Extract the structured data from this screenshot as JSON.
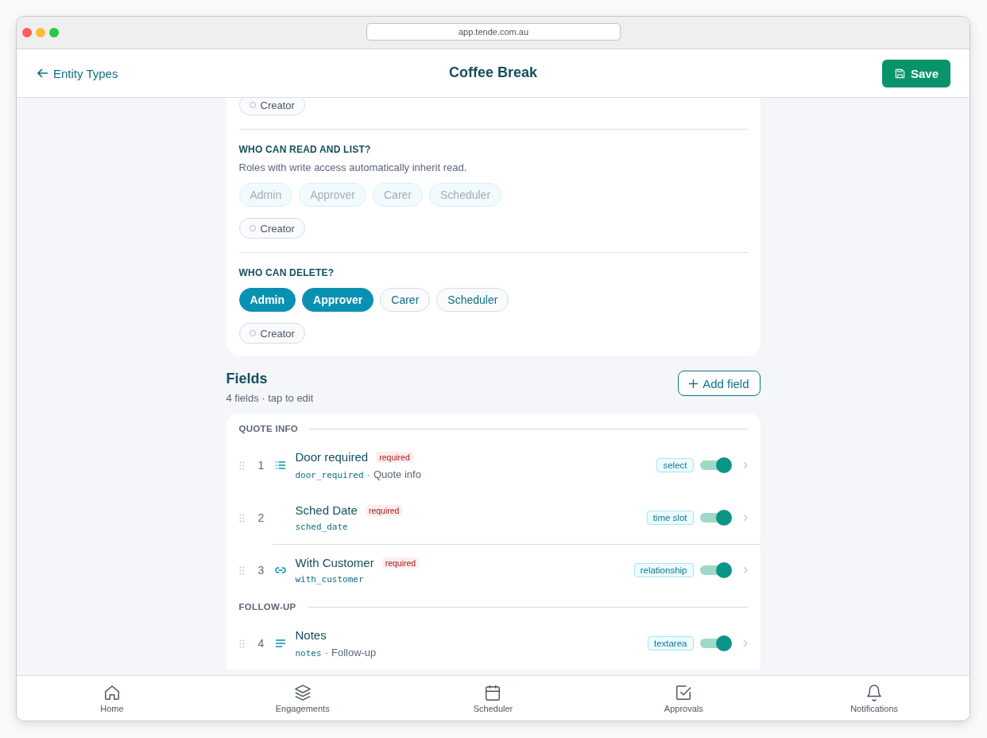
{
  "browser": {
    "url": "app.tende.com.au"
  },
  "header": {
    "back": "Entity Types",
    "title": "Coffee Break",
    "save": "Save"
  },
  "permissions": [
    {
      "roles": [
        {
          "label": "Creator",
          "kind": "creator",
          "selected": false,
          "disabled": false
        }
      ]
    },
    {
      "heading": "WHO CAN READ AND LIST?",
      "note": "Roles with write access automatically inherit read.",
      "roles": [
        {
          "label": "Admin",
          "kind": "role",
          "selected": false,
          "disabled": true
        },
        {
          "label": "Approver",
          "kind": "role",
          "selected": false,
          "disabled": true
        },
        {
          "label": "Carer",
          "kind": "role",
          "selected": false,
          "disabled": true
        },
        {
          "label": "Scheduler",
          "kind": "role",
          "selected": false,
          "disabled": true
        },
        {
          "label": "Creator",
          "kind": "creator",
          "selected": false,
          "disabled": false
        }
      ]
    },
    {
      "heading": "WHO CAN DELETE?",
      "roles": [
        {
          "label": "Admin",
          "kind": "role",
          "selected": true,
          "disabled": false
        },
        {
          "label": "Approver",
          "kind": "role",
          "selected": true,
          "disabled": false
        },
        {
          "label": "Carer",
          "kind": "role",
          "selected": false,
          "disabled": false
        },
        {
          "label": "Scheduler",
          "kind": "role",
          "selected": false,
          "disabled": false
        },
        {
          "label": "Creator",
          "kind": "creator",
          "selected": false,
          "disabled": false
        }
      ]
    }
  ],
  "fields": {
    "title": "Fields",
    "subtitle": "4 fields · tap to edit",
    "add_button": "Add field",
    "sections": [
      {
        "title": "QUOTE INFO",
        "items": [
          {
            "number": "1",
            "kind": "select",
            "name": "Door required",
            "badge": "required",
            "key": "door_required",
            "separator": "·",
            "group": "Quote info",
            "type": "select",
            "enabled": true,
            "divider_above": false
          },
          {
            "number": "2",
            "kind": "date",
            "name": "Sched Date",
            "badge": "required",
            "key": "sched_date",
            "type": "time slot",
            "enabled": true,
            "divider_above": false
          },
          {
            "number": "3",
            "kind": "relationship",
            "name": "With Customer",
            "badge": "required",
            "key": "with_customer",
            "type": "relationship",
            "enabled": true,
            "divider_above": true
          }
        ]
      },
      {
        "title": "FOLLOW-UP",
        "items": [
          {
            "number": "4",
            "kind": "text",
            "name": "Notes",
            "key": "notes",
            "separator": "·",
            "group": "Follow-up",
            "type": "textarea",
            "enabled": true,
            "divider_above": false
          }
        ]
      }
    ]
  },
  "nav": [
    {
      "label": "Home"
    },
    {
      "label": "Engagements"
    },
    {
      "label": "Scheduler"
    },
    {
      "label": "Approvals"
    },
    {
      "label": "Notifications"
    }
  ]
}
